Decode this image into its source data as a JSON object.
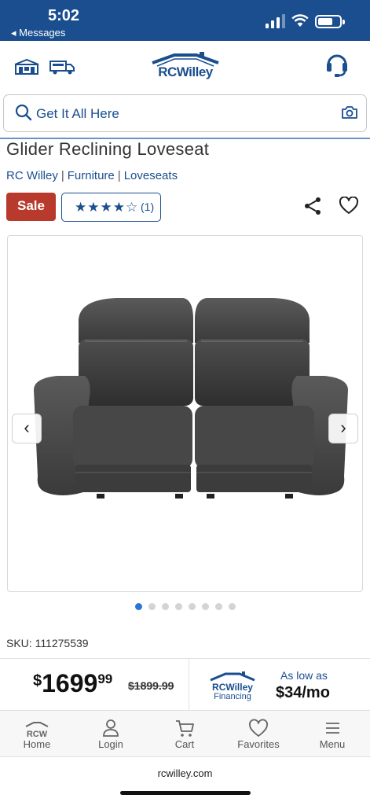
{
  "status_bar": {
    "time": "5:02",
    "back_label": "◂ Messages"
  },
  "header": {
    "logo_text": "RCWilley"
  },
  "search": {
    "placeholder": "Get It All Here"
  },
  "product": {
    "title": "Glider Reclining Loveseat",
    "breadcrumb": [
      "RC Willey",
      "Furniture",
      "Loveseats"
    ],
    "breadcrumb_separator": "|",
    "sale_badge": "Sale",
    "rating_stars": "★★★★☆",
    "rating_count": "(1)",
    "rating_value": 4,
    "sku": "SKU: 111275539"
  },
  "gallery": {
    "prev_label": "‹",
    "next_label": "›",
    "image_count": 8,
    "active_index": 0
  },
  "pricing": {
    "dollar_sign": "$",
    "price_main": "1699",
    "price_cents": "99",
    "was_price": "$1899.99",
    "financing_logo_text": "RCWilley",
    "financing_label": "Financing",
    "as_low_as": "As low as",
    "monthly": "$34/mo"
  },
  "bottom_nav": [
    {
      "label": "Home",
      "icon": "rcw-home-icon"
    },
    {
      "label": "Login",
      "icon": "user-icon"
    },
    {
      "label": "Cart",
      "icon": "cart-icon"
    },
    {
      "label": "Favorites",
      "icon": "heart-icon"
    },
    {
      "label": "Menu",
      "icon": "hamburger-icon"
    }
  ],
  "nav_home_logo_text": "RCW",
  "url": "rcwilley.com",
  "colors": {
    "brand_blue": "#1a4e8f",
    "sale_red": "#b73a2c",
    "active_dot": "#2b75d6"
  }
}
